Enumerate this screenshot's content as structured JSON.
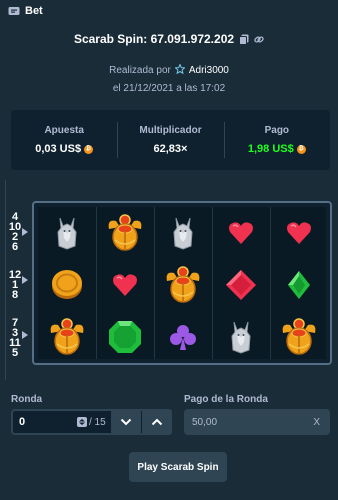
{
  "topbar": {
    "label": "Bet"
  },
  "header": {
    "game_title": "Scarab Spin: 67.091.972.202"
  },
  "meta": {
    "made_by_prefix": "Realizada por",
    "user": "Adri3000",
    "date_text": "el 21/12/2021 a las 17:02"
  },
  "stats": {
    "bet": {
      "label": "Apuesta",
      "value": "0,03 US$"
    },
    "multiplier": {
      "label": "Multiplicador",
      "value": "62,83×"
    },
    "payout": {
      "label": "Pago",
      "value": "1,98 US$"
    }
  },
  "reels": {
    "line_markers": {
      "row1": [
        "4",
        "10",
        "2",
        "6"
      ],
      "row2": [
        "12",
        "1",
        "8"
      ],
      "row3": [
        "7",
        "3",
        "11",
        "5"
      ]
    },
    "grid": [
      [
        "jackal-icon",
        "scarab-icon",
        "jackal-icon",
        "heart-icon",
        "heart-icon"
      ],
      [
        "coin-icon",
        "heart-icon",
        "scarab-icon",
        "red-diamond-icon",
        "green-diamond-icon"
      ],
      [
        "scarab-icon",
        "emerald-icon",
        "club-icon",
        "jackal-icon",
        "scarab-icon"
      ]
    ]
  },
  "round": {
    "label": "Ronda",
    "value": "0",
    "total": "/ 15"
  },
  "round_payout": {
    "label": "Pago de la Ronda",
    "value": "50,00",
    "suffix": "X"
  },
  "play_button": {
    "label": "Play Scarab Spin"
  },
  "colors": {
    "background": "#1a2c38",
    "panel": "#0f212e",
    "muted_text": "#b1bad3",
    "green": "#1fff20",
    "border": "#2f4553",
    "coin": "#f7931a"
  }
}
